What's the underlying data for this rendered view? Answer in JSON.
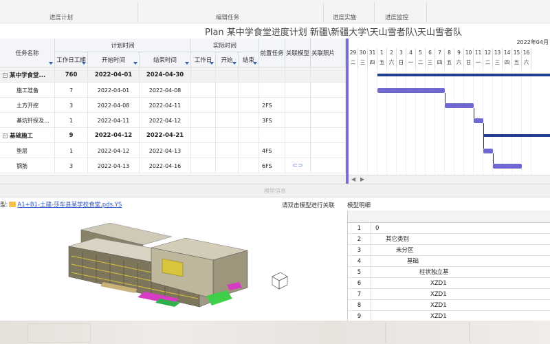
{
  "toolbar": {
    "sections": [
      "进度计划",
      "编辑任务",
      "进度实施",
      "进度监控"
    ]
  },
  "plan_title": "Plan 某中学食堂进度计划 新疆\\新疆大学\\天山雪者队\\天山雪者队",
  "grid": {
    "headers": {
      "task_name": "任务名称",
      "planned_time": "计划时间",
      "actual_time": "实际时间",
      "work_days": "工作日工期",
      "start_time": "开始时间",
      "end_time": "结束时间",
      "actual_work_days": "工作日",
      "actual_start": "开始",
      "actual_end": "结束",
      "predecessor": "前置任务",
      "linked_model": "关联模型",
      "linked_photo": "关联照片"
    },
    "rows": [
      {
        "name": "某中学食堂...",
        "days": "760",
        "start": "2022-04-01",
        "end": "2024-04-30",
        "pred": "",
        "summary": true,
        "toggle": "−"
      },
      {
        "name": "施工准备",
        "days": "7",
        "start": "2022-04-01",
        "end": "2022-04-08",
        "pred": "",
        "summary": false
      },
      {
        "name": "土方开挖",
        "days": "3",
        "start": "2022-04-08",
        "end": "2022-04-11",
        "pred": "2FS",
        "summary": false
      },
      {
        "name": "基坑钎探及...",
        "days": "1",
        "start": "2022-04-11",
        "end": "2022-04-12",
        "pred": "3FS",
        "summary": false
      },
      {
        "name": "基础施工",
        "days": "9",
        "start": "2022-04-12",
        "end": "2022-04-21",
        "pred": "",
        "summary": true,
        "toggle": "−"
      },
      {
        "name": "垫层",
        "days": "1",
        "start": "2022-04-12",
        "end": "2022-04-13",
        "pred": "4FS",
        "summary": false
      },
      {
        "name": "钢筋",
        "days": "3",
        "start": "2022-04-13",
        "end": "2022-04-16",
        "pred": "6FS",
        "summary": false,
        "link": "⊂⊃"
      }
    ]
  },
  "gantt": {
    "month_label": "2022年04月",
    "days": [
      {
        "d": "29",
        "w": "二"
      },
      {
        "d": "30",
        "w": "三"
      },
      {
        "d": "31",
        "w": "四"
      },
      {
        "d": "1",
        "w": "五"
      },
      {
        "d": "2",
        "w": "六"
      },
      {
        "d": "3",
        "w": "日"
      },
      {
        "d": "4",
        "w": "一"
      },
      {
        "d": "5",
        "w": "二"
      },
      {
        "d": "6",
        "w": "三"
      },
      {
        "d": "7",
        "w": "四"
      },
      {
        "d": "8",
        "w": "五"
      },
      {
        "d": "9",
        "w": "六"
      },
      {
        "d": "10",
        "w": "日"
      },
      {
        "d": "11",
        "w": "一"
      },
      {
        "d": "12",
        "w": "二"
      },
      {
        "d": "13",
        "w": "三"
      },
      {
        "d": "14",
        "w": "四"
      },
      {
        "d": "15",
        "w": "五"
      },
      {
        "d": "16",
        "w": "六"
      }
    ]
  },
  "model": {
    "section_title": "模型信息",
    "path_prefix": "型:",
    "file_name": "A1+B1-土建-莎车县某学校食堂.pds.YS",
    "hint": "请双击模型进行关联",
    "detail_title": "模型明细",
    "detail_rows": [
      {
        "n": "1",
        "v": "0",
        "level": 0
      },
      {
        "n": "2",
        "v": "其它类别",
        "level": 1
      },
      {
        "n": "3",
        "v": "未分区",
        "level": 2
      },
      {
        "n": "4",
        "v": "基础",
        "level": 3
      },
      {
        "n": "5",
        "v": "柱状独立基",
        "level": 4
      },
      {
        "n": "6",
        "v": "XZD1",
        "level": 5
      },
      {
        "n": "7",
        "v": "XZD1",
        "level": 5
      },
      {
        "n": "8",
        "v": "XZD1",
        "level": 5
      },
      {
        "n": "9",
        "v": "XZD1",
        "level": 5
      }
    ]
  }
}
